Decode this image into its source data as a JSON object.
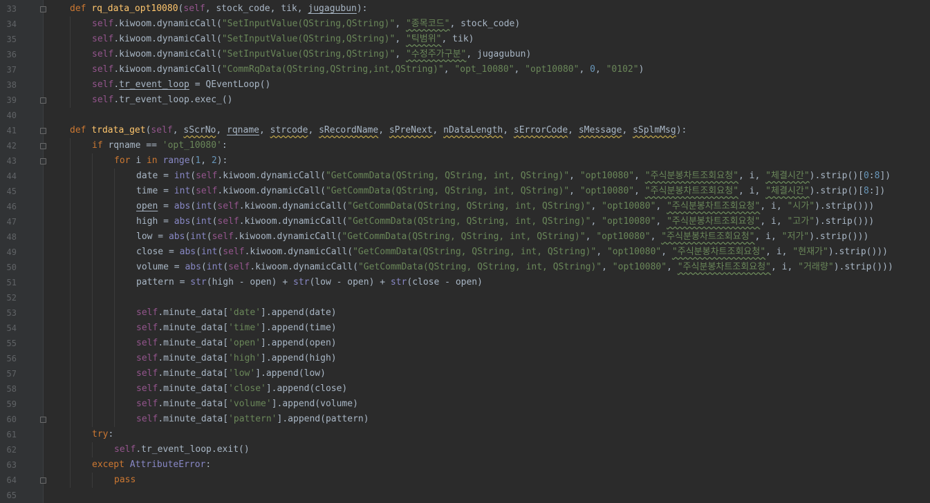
{
  "editor": {
    "theme_colors": {
      "background": "#2b2b2b",
      "gutter": "#313335",
      "keyword": "#cc7832",
      "function_name": "#ffc66d",
      "self": "#94558d",
      "string": "#6a8759",
      "number": "#6897bb",
      "builtin": "#8888c6",
      "text": "#a9b7c6"
    },
    "line_numbers": [
      "33",
      "34",
      "35",
      "36",
      "37",
      "38",
      "39",
      "40",
      "41",
      "42",
      "43",
      "44",
      "45",
      "46",
      "47",
      "48",
      "49",
      "50",
      "51",
      "52",
      "53",
      "54",
      "55",
      "56",
      "57",
      "58",
      "59",
      "60",
      "61",
      "62",
      "63",
      "64",
      "65"
    ],
    "lines": [
      {
        "indent": 0,
        "tokens": [
          [
            "kw",
            "def "
          ],
          [
            "fn",
            "rq_data_opt10080"
          ],
          [
            "pa",
            "("
          ],
          [
            "sf",
            "self"
          ],
          [
            "pa",
            ", stock_code, tik, "
          ],
          [
            "ul",
            "jugagubun"
          ],
          [
            "pa",
            "):"
          ]
        ]
      },
      {
        "indent": 1,
        "tokens": [
          [
            "sf",
            "self"
          ],
          [
            "pa",
            ".kiwoom.dynamicCall("
          ],
          [
            "st",
            "\"SetInputValue(QString,QString)\""
          ],
          [
            "pa",
            ", "
          ],
          [
            "st wv",
            "\"종목코드\""
          ],
          [
            "pa",
            ", stock_code)"
          ]
        ]
      },
      {
        "indent": 1,
        "tokens": [
          [
            "sf",
            "self"
          ],
          [
            "pa",
            ".kiwoom.dynamicCall("
          ],
          [
            "st",
            "\"SetInputValue(QString,QString)\""
          ],
          [
            "pa",
            ", "
          ],
          [
            "st wv",
            "\"틱범위\""
          ],
          [
            "pa",
            ", tik)"
          ]
        ]
      },
      {
        "indent": 1,
        "tokens": [
          [
            "sf",
            "self"
          ],
          [
            "pa",
            ".kiwoom.dynamicCall("
          ],
          [
            "st",
            "\"SetInputValue(QString,QString)\""
          ],
          [
            "pa",
            ", "
          ],
          [
            "st wv",
            "\"수정주가구분\""
          ],
          [
            "pa",
            ", jugagubun)"
          ]
        ]
      },
      {
        "indent": 1,
        "tokens": [
          [
            "sf",
            "self"
          ],
          [
            "pa",
            ".kiwoom.dynamicCall("
          ],
          [
            "st",
            "\"CommRqData(QString,QString,int,QString)\""
          ],
          [
            "pa",
            ", "
          ],
          [
            "st",
            "\"opt_10080\""
          ],
          [
            "pa",
            ", "
          ],
          [
            "st",
            "\"opt10080\""
          ],
          [
            "pa",
            ", "
          ],
          [
            "nu",
            "0"
          ],
          [
            "pa",
            ", "
          ],
          [
            "st",
            "\"0102\""
          ],
          [
            "pa",
            ")"
          ]
        ]
      },
      {
        "indent": 1,
        "tokens": [
          [
            "sf",
            "self"
          ],
          [
            "pa",
            "."
          ],
          [
            "ul",
            "tr_event_loop"
          ],
          [
            "pa",
            " = QEventLoop()"
          ]
        ]
      },
      {
        "indent": 1,
        "tokens": [
          [
            "sf",
            "self"
          ],
          [
            "pa",
            ".tr_event_loop.exec_()"
          ]
        ]
      },
      {
        "indent": 0,
        "tokens": []
      },
      {
        "indent": 0,
        "tokens": [
          [
            "kw",
            "def "
          ],
          [
            "fn",
            "trdata_get"
          ],
          [
            "pa",
            "("
          ],
          [
            "sf",
            "self"
          ],
          [
            "pa",
            ", "
          ],
          [
            "wvp",
            "sScrNo"
          ],
          [
            "pa",
            ", "
          ],
          [
            "ul",
            "rqname"
          ],
          [
            "pa",
            ", "
          ],
          [
            "wvp",
            "strcode"
          ],
          [
            "pa",
            ", "
          ],
          [
            "wvp",
            "sRecordName"
          ],
          [
            "pa",
            ", "
          ],
          [
            "wvp",
            "sPreNext"
          ],
          [
            "pa",
            ", "
          ],
          [
            "wvp",
            "nDataLength"
          ],
          [
            "pa",
            ", "
          ],
          [
            "wvp",
            "sErrorCode"
          ],
          [
            "pa",
            ", "
          ],
          [
            "wvp",
            "sMessage"
          ],
          [
            "pa",
            ", "
          ],
          [
            "wvp",
            "sSplmMsg"
          ],
          [
            "pa",
            "):"
          ]
        ]
      },
      {
        "indent": 1,
        "tokens": [
          [
            "kw",
            "if "
          ],
          [
            "pa",
            "rqname == "
          ],
          [
            "st",
            "'opt_10080'"
          ],
          [
            "pa",
            ":"
          ]
        ]
      },
      {
        "indent": 2,
        "tokens": [
          [
            "kw",
            "for "
          ],
          [
            "pa",
            "i "
          ],
          [
            "kw",
            "in "
          ],
          [
            "bi",
            "range"
          ],
          [
            "pa",
            "("
          ],
          [
            "nu",
            "1"
          ],
          [
            "pa",
            ", "
          ],
          [
            "nu",
            "2"
          ],
          [
            "pa",
            "):"
          ]
        ]
      },
      {
        "indent": 3,
        "tokens": [
          [
            "pa",
            "date = "
          ],
          [
            "bi",
            "int"
          ],
          [
            "pa",
            "("
          ],
          [
            "sf",
            "self"
          ],
          [
            "pa",
            ".kiwoom.dynamicCall("
          ],
          [
            "st",
            "\"GetCommData(QString, QString, int, QString)\""
          ],
          [
            "pa",
            ", "
          ],
          [
            "st",
            "\"opt10080\""
          ],
          [
            "pa",
            ", "
          ],
          [
            "st wv",
            "\"주식분봉차트조회요청\""
          ],
          [
            "pa",
            ", i, "
          ],
          [
            "st wv",
            "\"체결시간\""
          ],
          [
            "pa",
            ").strip()["
          ],
          [
            "nu",
            "0"
          ],
          [
            "pa",
            ":"
          ],
          [
            "nu",
            "8"
          ],
          [
            "pa",
            "])"
          ]
        ]
      },
      {
        "indent": 3,
        "tokens": [
          [
            "pa",
            "time = "
          ],
          [
            "bi",
            "int"
          ],
          [
            "pa",
            "("
          ],
          [
            "sf",
            "self"
          ],
          [
            "pa",
            ".kiwoom.dynamicCall("
          ],
          [
            "st",
            "\"GetCommData(QString, QString, int, QString)\""
          ],
          [
            "pa",
            ", "
          ],
          [
            "st",
            "\"opt10080\""
          ],
          [
            "pa",
            ", "
          ],
          [
            "st wv",
            "\"주식분봉차트조회요청\""
          ],
          [
            "pa",
            ", i, "
          ],
          [
            "st wv",
            "\"체결시간\""
          ],
          [
            "pa",
            ").strip()["
          ],
          [
            "nu",
            "8"
          ],
          [
            "pa",
            ":])"
          ]
        ]
      },
      {
        "indent": 3,
        "tokens": [
          [
            "ul",
            "open"
          ],
          [
            "pa",
            " = "
          ],
          [
            "bi",
            "abs"
          ],
          [
            "pa",
            "("
          ],
          [
            "bi",
            "int"
          ],
          [
            "pa",
            "("
          ],
          [
            "sf",
            "self"
          ],
          [
            "pa",
            ".kiwoom.dynamicCall("
          ],
          [
            "st",
            "\"GetCommData(QString, QString, int, QString)\""
          ],
          [
            "pa",
            ", "
          ],
          [
            "st",
            "\"opt10080\""
          ],
          [
            "pa",
            ", "
          ],
          [
            "st wv",
            "\"주식분봉차트조회요청\""
          ],
          [
            "pa",
            ", i, "
          ],
          [
            "st",
            "\"시가\""
          ],
          [
            "pa",
            ").strip()))"
          ]
        ]
      },
      {
        "indent": 3,
        "tokens": [
          [
            "pa",
            "high = "
          ],
          [
            "bi",
            "abs"
          ],
          [
            "pa",
            "("
          ],
          [
            "bi",
            "int"
          ],
          [
            "pa",
            "("
          ],
          [
            "sf",
            "self"
          ],
          [
            "pa",
            ".kiwoom.dynamicCall("
          ],
          [
            "st",
            "\"GetCommData(QString, QString, int, QString)\""
          ],
          [
            "pa",
            ", "
          ],
          [
            "st",
            "\"opt10080\""
          ],
          [
            "pa",
            ", "
          ],
          [
            "st wv",
            "\"주식분봉차트조회요청\""
          ],
          [
            "pa",
            ", i, "
          ],
          [
            "st",
            "\"고가\""
          ],
          [
            "pa",
            ").strip()))"
          ]
        ]
      },
      {
        "indent": 3,
        "tokens": [
          [
            "pa",
            "low = "
          ],
          [
            "bi",
            "abs"
          ],
          [
            "pa",
            "("
          ],
          [
            "bi",
            "int"
          ],
          [
            "pa",
            "("
          ],
          [
            "sf",
            "self"
          ],
          [
            "pa",
            ".kiwoom.dynamicCall("
          ],
          [
            "st",
            "\"GetCommData(QString, QString, int, QString)\""
          ],
          [
            "pa",
            ", "
          ],
          [
            "st",
            "\"opt10080\""
          ],
          [
            "pa",
            ", "
          ],
          [
            "st wv",
            "\"주식분봉차트조회요청\""
          ],
          [
            "pa",
            ", i, "
          ],
          [
            "st",
            "\"저가\""
          ],
          [
            "pa",
            ").strip()))"
          ]
        ]
      },
      {
        "indent": 3,
        "tokens": [
          [
            "pa",
            "close = "
          ],
          [
            "bi",
            "abs"
          ],
          [
            "pa",
            "("
          ],
          [
            "bi",
            "int"
          ],
          [
            "pa",
            "("
          ],
          [
            "sf",
            "self"
          ],
          [
            "pa",
            ".kiwoom.dynamicCall("
          ],
          [
            "st",
            "\"GetCommData(QString, QString, int, QString)\""
          ],
          [
            "pa",
            ", "
          ],
          [
            "st",
            "\"opt10080\""
          ],
          [
            "pa",
            ", "
          ],
          [
            "st wv",
            "\"주식분봉차트조회요청\""
          ],
          [
            "pa",
            ", i, "
          ],
          [
            "st",
            "\"현재가\""
          ],
          [
            "pa",
            ").strip()))"
          ]
        ]
      },
      {
        "indent": 3,
        "tokens": [
          [
            "pa",
            "volume = "
          ],
          [
            "bi",
            "abs"
          ],
          [
            "pa",
            "("
          ],
          [
            "bi",
            "int"
          ],
          [
            "pa",
            "("
          ],
          [
            "sf",
            "self"
          ],
          [
            "pa",
            ".kiwoom.dynamicCall("
          ],
          [
            "st",
            "\"GetCommData(QString, QString, int, QString)\""
          ],
          [
            "pa",
            ", "
          ],
          [
            "st",
            "\"opt10080\""
          ],
          [
            "pa",
            ", "
          ],
          [
            "st wv",
            "\"주식분봉차트조회요청\""
          ],
          [
            "pa",
            ", i, "
          ],
          [
            "st",
            "\"거래량\""
          ],
          [
            "pa",
            ").strip()))"
          ]
        ]
      },
      {
        "indent": 3,
        "tokens": [
          [
            "pa",
            "pattern = "
          ],
          [
            "bi",
            "str"
          ],
          [
            "pa",
            "(high - open) + "
          ],
          [
            "bi",
            "str"
          ],
          [
            "pa",
            "(low - open) + "
          ],
          [
            "bi",
            "str"
          ],
          [
            "pa",
            "(close - open)"
          ]
        ]
      },
      {
        "indent": 0,
        "tokens": []
      },
      {
        "indent": 3,
        "tokens": [
          [
            "sf",
            "self"
          ],
          [
            "pa",
            ".minute_data["
          ],
          [
            "st",
            "'date'"
          ],
          [
            "pa",
            "].append(date)"
          ]
        ]
      },
      {
        "indent": 3,
        "tokens": [
          [
            "sf",
            "self"
          ],
          [
            "pa",
            ".minute_data["
          ],
          [
            "st",
            "'time'"
          ],
          [
            "pa",
            "].append(time)"
          ]
        ]
      },
      {
        "indent": 3,
        "tokens": [
          [
            "sf",
            "self"
          ],
          [
            "pa",
            ".minute_data["
          ],
          [
            "st",
            "'open'"
          ],
          [
            "pa",
            "].append(open)"
          ]
        ]
      },
      {
        "indent": 3,
        "tokens": [
          [
            "sf",
            "self"
          ],
          [
            "pa",
            ".minute_data["
          ],
          [
            "st",
            "'high'"
          ],
          [
            "pa",
            "].append(high)"
          ]
        ]
      },
      {
        "indent": 3,
        "tokens": [
          [
            "sf",
            "self"
          ],
          [
            "pa",
            ".minute_data["
          ],
          [
            "st",
            "'low'"
          ],
          [
            "pa",
            "].append(low)"
          ]
        ]
      },
      {
        "indent": 3,
        "tokens": [
          [
            "sf",
            "self"
          ],
          [
            "pa",
            ".minute_data["
          ],
          [
            "st",
            "'close'"
          ],
          [
            "pa",
            "].append(close)"
          ]
        ]
      },
      {
        "indent": 3,
        "tokens": [
          [
            "sf",
            "self"
          ],
          [
            "pa",
            ".minute_data["
          ],
          [
            "st",
            "'volume'"
          ],
          [
            "pa",
            "].append(volume)"
          ]
        ]
      },
      {
        "indent": 3,
        "tokens": [
          [
            "sf",
            "self"
          ],
          [
            "pa",
            ".minute_data["
          ],
          [
            "st",
            "'pattern'"
          ],
          [
            "pa",
            "].append(pattern)"
          ]
        ]
      },
      {
        "indent": 1,
        "tokens": [
          [
            "kw",
            "try"
          ],
          [
            "pa",
            ":"
          ]
        ]
      },
      {
        "indent": 2,
        "tokens": [
          [
            "sf",
            "self"
          ],
          [
            "pa",
            ".tr_event_loop.exit()"
          ]
        ]
      },
      {
        "indent": 1,
        "tokens": [
          [
            "kw",
            "except "
          ],
          [
            "bi",
            "AttributeError"
          ],
          [
            "pa",
            ":"
          ]
        ]
      },
      {
        "indent": 2,
        "tokens": [
          [
            "kw",
            "pass"
          ]
        ]
      },
      {
        "indent": 0,
        "tokens": []
      }
    ]
  }
}
